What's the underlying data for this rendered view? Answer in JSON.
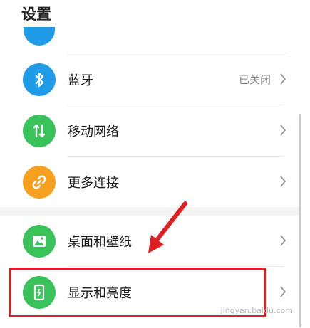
{
  "header": {
    "title": "设置"
  },
  "settings": {
    "bluetooth": {
      "label": "蓝牙",
      "value": "已关闭",
      "icon": "bluetooth-icon",
      "color": "#1f9be8"
    },
    "mobile_network": {
      "label": "移动网络",
      "icon": "mobile-data-icon",
      "color": "#3ac25a"
    },
    "more_connections": {
      "label": "更多连接",
      "icon": "link-icon",
      "color": "#f7a020"
    },
    "wallpaper": {
      "label": "桌面和壁纸",
      "icon": "image-icon",
      "color": "#3ac25a"
    },
    "display": {
      "label": "显示和亮度",
      "icon": "display-brightness-icon",
      "color": "#3ac25a"
    }
  },
  "annotation": {
    "highlight_color": "#e02020"
  },
  "watermark": {
    "text": "jingyan.baidu.com"
  }
}
